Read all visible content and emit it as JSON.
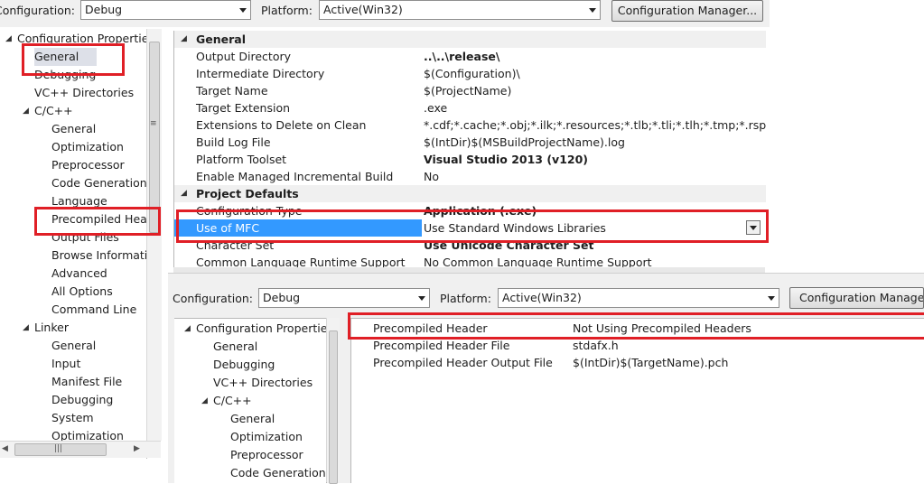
{
  "top": {
    "configuration_label": "Configuration:",
    "configuration_value": "Debug",
    "platform_label": "Platform:",
    "platform_value": "Active(Win32)",
    "config_manager": "Configuration Manager..."
  },
  "tree_top": [
    {
      "label": "Configuration Properties",
      "level": 0,
      "toggle": "◢"
    },
    {
      "label": "General",
      "level": 1,
      "selected": true
    },
    {
      "label": "Debugging",
      "level": 1
    },
    {
      "label": "VC++ Directories",
      "level": 1
    },
    {
      "label": "C/C++",
      "level": 1,
      "toggle": "◢"
    },
    {
      "label": "General",
      "level": 2
    },
    {
      "label": "Optimization",
      "level": 2
    },
    {
      "label": "Preprocessor",
      "level": 2
    },
    {
      "label": "Code Generation",
      "level": 2
    },
    {
      "label": "Language",
      "level": 2
    },
    {
      "label": "Precompiled Headers",
      "level": 2
    },
    {
      "label": "Output Files",
      "level": 2
    },
    {
      "label": "Browse Information",
      "level": 2
    },
    {
      "label": "Advanced",
      "level": 2
    },
    {
      "label": "All Options",
      "level": 2
    },
    {
      "label": "Command Line",
      "level": 2
    },
    {
      "label": "Linker",
      "level": 1,
      "toggle": "◢"
    },
    {
      "label": "General",
      "level": 2
    },
    {
      "label": "Input",
      "level": 2
    },
    {
      "label": "Manifest File",
      "level": 2
    },
    {
      "label": "Debugging",
      "level": 2
    },
    {
      "label": "System",
      "level": 2
    },
    {
      "label": "Optimization",
      "level": 2
    }
  ],
  "grid_top": [
    {
      "type": "cat",
      "key": "General",
      "toggle": "◢"
    },
    {
      "key": "Output Directory",
      "value": "..\\..\\release\\",
      "bold": true
    },
    {
      "key": "Intermediate Directory",
      "value": "$(Configuration)\\"
    },
    {
      "key": "Target Name",
      "value": "$(ProjectName)"
    },
    {
      "key": "Target Extension",
      "value": ".exe"
    },
    {
      "key": "Extensions to Delete on Clean",
      "value": "*.cdf;*.cache;*.obj;*.ilk;*.resources;*.tlb;*.tli;*.tlh;*.tmp;*.rsp;*.pgc;*.p"
    },
    {
      "key": "Build Log File",
      "value": "$(IntDir)$(MSBuildProjectName).log"
    },
    {
      "key": "Platform Toolset",
      "value": "Visual Studio 2013 (v120)",
      "bold": true
    },
    {
      "key": "Enable Managed Incremental Build",
      "value": "No"
    },
    {
      "type": "cat",
      "key": "Project Defaults",
      "toggle": "◢"
    },
    {
      "key": "Configuration Type",
      "value": "Application (.exe)",
      "bold": true
    },
    {
      "key": "Use of MFC",
      "value": "Use Standard Windows Libraries",
      "selected": true
    },
    {
      "key": "Character Set",
      "value": "Use Unicode Character Set",
      "bold": true
    },
    {
      "key": "Common Language Runtime Support",
      "value": "No Common Language Runtime Support"
    }
  ],
  "bottom": {
    "configuration_label": "Configuration:",
    "configuration_value": "Debug",
    "platform_label": "Platform:",
    "platform_value": "Active(Win32)",
    "config_manager": "Configuration Manager..."
  },
  "tree_bottom": [
    {
      "label": "Configuration Properties",
      "level": 0,
      "toggle": "◢"
    },
    {
      "label": "General",
      "level": 1
    },
    {
      "label": "Debugging",
      "level": 1
    },
    {
      "label": "VC++ Directories",
      "level": 1
    },
    {
      "label": "C/C++",
      "level": 1,
      "toggle": "◢"
    },
    {
      "label": "General",
      "level": 2
    },
    {
      "label": "Optimization",
      "level": 2
    },
    {
      "label": "Preprocessor",
      "level": 2
    },
    {
      "label": "Code Generation",
      "level": 2
    }
  ],
  "grid_bottom": [
    {
      "key": "Precompiled Header",
      "value": "Not Using Precompiled Headers"
    },
    {
      "key": "Precompiled Header File",
      "value": "stdafx.h"
    },
    {
      "key": "Precompiled Header Output File",
      "value": "$(IntDir)$(TargetName).pch"
    }
  ],
  "colors": {
    "highlight": "#3399ff",
    "annotation": "#e01f26"
  }
}
